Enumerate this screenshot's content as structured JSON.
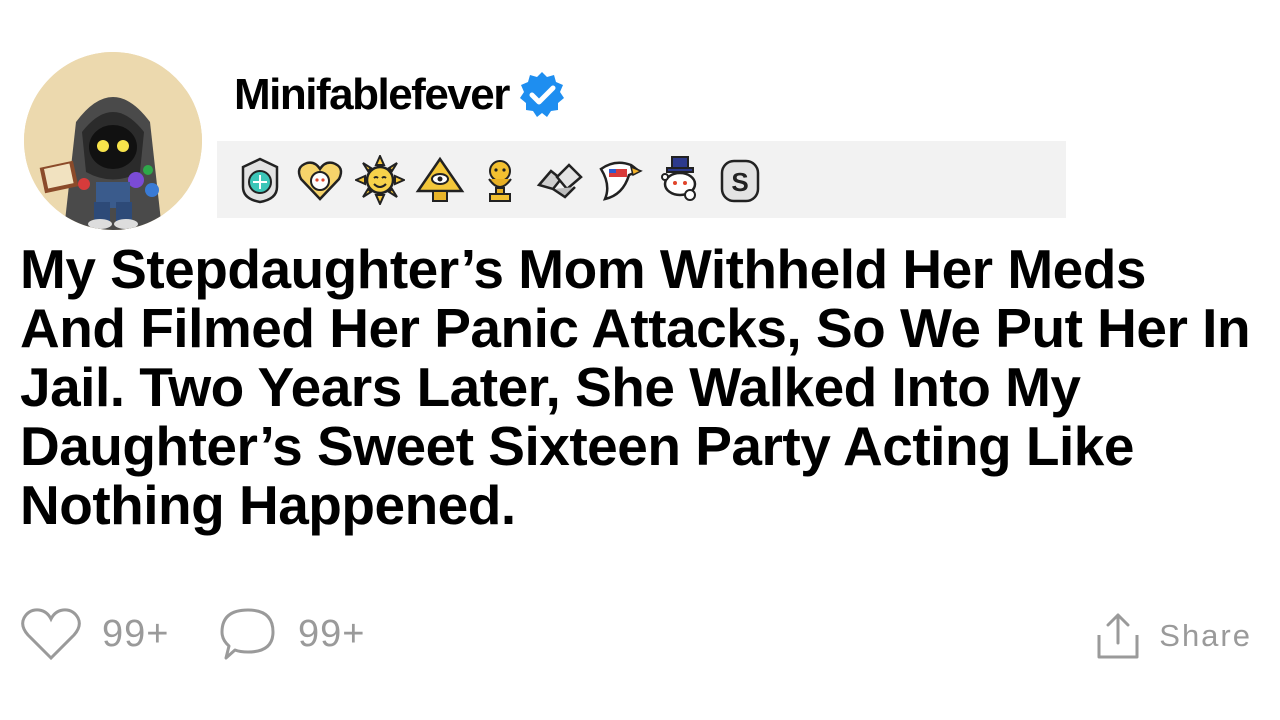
{
  "post": {
    "username": "Minifablefever",
    "verified": true,
    "title": "My Stepdaughter’s Mom Withheld Her Meds And Filmed Her Panic Attacks, So We Put Her In Jail. Two Years Later, She Walked Into My Daughter’s Sweet Sixteen Party Acting Like Nothing Happened.",
    "awards": [
      {
        "icon": "silver-shield-award-icon"
      },
      {
        "icon": "wholesome-heart-award-icon"
      },
      {
        "icon": "sun-smile-award-icon"
      },
      {
        "icon": "pyramid-eye-award-icon"
      },
      {
        "icon": "gold-trophy-award-icon"
      },
      {
        "icon": "handshake-award-icon"
      },
      {
        "icon": "eagle-flag-award-icon"
      },
      {
        "icon": "top-hat-snoo-award-icon"
      },
      {
        "icon": "silver-s-award-icon"
      }
    ]
  },
  "footer": {
    "likes_count": "99+",
    "comments_count": "99+",
    "share_label": "Share"
  },
  "colors": {
    "verified_badge": "#1e8ef0",
    "muted_text": "#9a9a9a",
    "award_bar_bg": "#f2f2f2"
  }
}
